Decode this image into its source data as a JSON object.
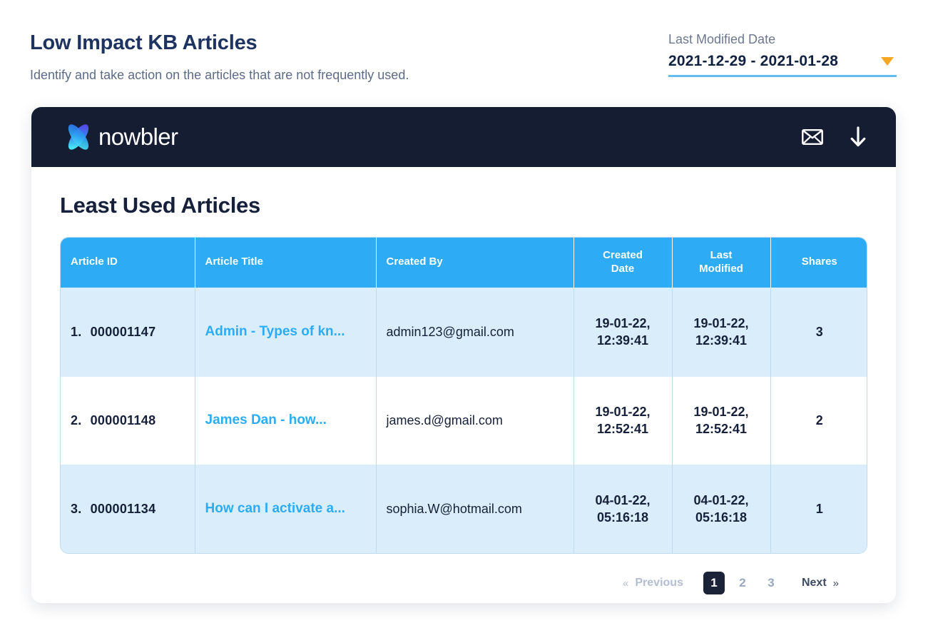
{
  "header": {
    "title": "Low Impact KB Articles",
    "subtitle": "Identify and take action on the articles that are not frequently used."
  },
  "date_filter": {
    "label": "Last Modified Date",
    "value": "2021-12-29  -  2021-01-28",
    "caret_icon": "caret-down-icon",
    "accent_color": "#f5a623",
    "underline_color": "#64bdf0"
  },
  "card": {
    "brand": {
      "logo_icon": "knowbler-logo-icon",
      "name": "nowbler",
      "background": "#151d33"
    },
    "actions": [
      {
        "name": "mail-icon",
        "label": "Mail"
      },
      {
        "name": "download-icon",
        "label": "Download"
      }
    ],
    "section_title": "Least Used Articles"
  },
  "table": {
    "columns": [
      {
        "key": "article_id",
        "label": "Article ID",
        "align": "left"
      },
      {
        "key": "article_title",
        "label": "Article Title",
        "align": "left"
      },
      {
        "key": "created_by",
        "label": "Created By",
        "align": "left"
      },
      {
        "key": "created_date",
        "label": "Created\nDate",
        "label_line1": "Created",
        "label_line2": "Date",
        "align": "center"
      },
      {
        "key": "last_modified",
        "label": "Last\nModified",
        "label_line1": "Last",
        "label_line2": "Modified",
        "align": "center"
      },
      {
        "key": "shares",
        "label": "Shares",
        "align": "center"
      }
    ],
    "header_bg": "#2dacf5",
    "row_alt_bg": "#d9eefa",
    "rows": [
      {
        "rank": "1.",
        "article_id": "000001147",
        "article_title": "Admin - Types of kn...",
        "created_by": "admin123@gmail.com",
        "created_date_line1": "19-01-22,",
        "created_date_line2": "12:39:41",
        "last_modified_line1": "19-01-22,",
        "last_modified_line2": "12:39:41",
        "shares": "3"
      },
      {
        "rank": "2.",
        "article_id": "000001148",
        "article_title": "James Dan - how...",
        "created_by": "james.d@gmail.com",
        "created_date_line1": "19-01-22,",
        "created_date_line2": "12:52:41",
        "last_modified_line1": "19-01-22,",
        "last_modified_line2": "12:52:41",
        "shares": "2"
      },
      {
        "rank": "3.",
        "article_id": "000001134",
        "article_title": "How can I activate a...",
        "created_by": "sophia.W@hotmail.com",
        "created_date_line1": "04-01-22,",
        "created_date_line2": "05:16:18",
        "last_modified_line1": "04-01-22,",
        "last_modified_line2": "05:16:18",
        "shares": "1"
      }
    ]
  },
  "pagination": {
    "previous_label": "Previous",
    "previous_chevron": "«",
    "next_label": "Next",
    "next_chevron": "»",
    "pages": [
      "1",
      "2",
      "3"
    ],
    "active_page": "1"
  }
}
